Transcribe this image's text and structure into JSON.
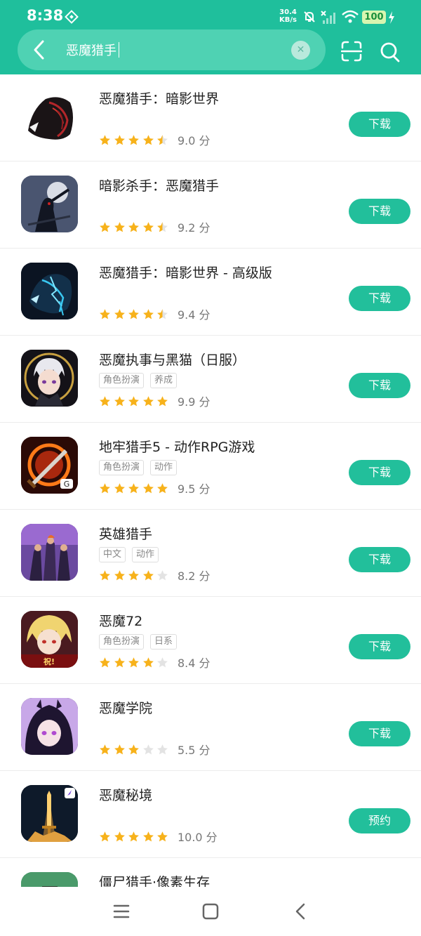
{
  "status_bar": {
    "time": "8:38",
    "net_speed_value": "30.4",
    "net_speed_unit": "KB/s",
    "battery": "100",
    "icons": [
      "shield-icon",
      "bell-off-icon",
      "signal-icon",
      "wifi-icon",
      "battery-icon",
      "charging-icon"
    ]
  },
  "search": {
    "query": "恶魔猎手"
  },
  "colors": {
    "brand": "#1fbf9c",
    "button": "#22bf9b",
    "star_on": "#f7b21b",
    "star_off": "#e3e3e3"
  },
  "apps": [
    {
      "name": "恶魔猎手：暗影世界",
      "tags": [],
      "rating": 4.5,
      "score": "9.0 分",
      "button": "下载",
      "icon": "black-red-wolf-icon"
    },
    {
      "name": "暗影杀手：恶魔猎手",
      "tags": [],
      "rating": 4.5,
      "score": "9.2 分",
      "button": "下载",
      "icon": "shadow-warrior-moon-icon"
    },
    {
      "name": "恶魔猎手：暗影世界 - 高级版",
      "tags": [],
      "rating": 4.5,
      "score": "9.4 分",
      "button": "下载",
      "icon": "blue-lightning-wolf-icon"
    },
    {
      "name": "恶魔执事与黑猫（日服）",
      "tags": [
        "角色扮演",
        "养成"
      ],
      "rating": 5,
      "score": "9.9 分",
      "button": "下载",
      "icon": "anime-butler-icon"
    },
    {
      "name": "地牢猎手5 - 动作RPG游戏",
      "tags": [
        "角色扮演",
        "动作"
      ],
      "rating": 5,
      "score": "9.5 分",
      "button": "下载",
      "icon": "flaming-sword-icon"
    },
    {
      "name": "英雄猎手",
      "tags": [
        "中文",
        "动作"
      ],
      "rating": 4,
      "score": "8.2 分",
      "button": "下载",
      "icon": "hero-squad-icon"
    },
    {
      "name": "恶魔72",
      "tags": [
        "角色扮演",
        "日系"
      ],
      "rating": 4,
      "score": "8.4 分",
      "button": "下载",
      "icon": "anime-blonde-icon"
    },
    {
      "name": "恶魔学院",
      "tags": [],
      "rating": 3,
      "score": "5.5 分",
      "button": "下载",
      "icon": "anime-demon-girl-icon"
    },
    {
      "name": "恶魔秘境",
      "tags": [],
      "rating": 5,
      "score": "10.0 分",
      "button": "预约",
      "icon": "golden-sword-icon"
    },
    {
      "name": "僵尸猎手·像素生存",
      "tags": [],
      "rating": 0,
      "score": "",
      "button": "",
      "icon": "pixel-zombie-icon"
    }
  ],
  "nav": {
    "icons": [
      "menu-icon",
      "home-square-icon",
      "back-chevron-icon"
    ]
  }
}
